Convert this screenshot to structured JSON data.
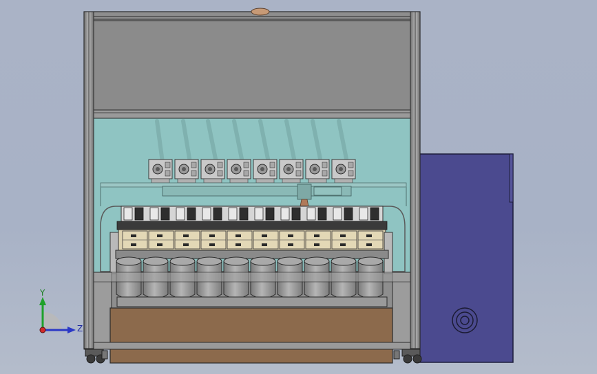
{
  "triad": {
    "y_label": "Y",
    "z_label": "Z"
  },
  "machine": {
    "nozzle_count": 8,
    "cup_count": 10,
    "colors": {
      "frame": "#8e8e8e",
      "top_panel": "#8b8b8b",
      "glass": "#8fc4c2",
      "side_cabinet": "#4b4a8f",
      "base": "#8c6a4c",
      "cup": "#9e9e9e"
    }
  }
}
